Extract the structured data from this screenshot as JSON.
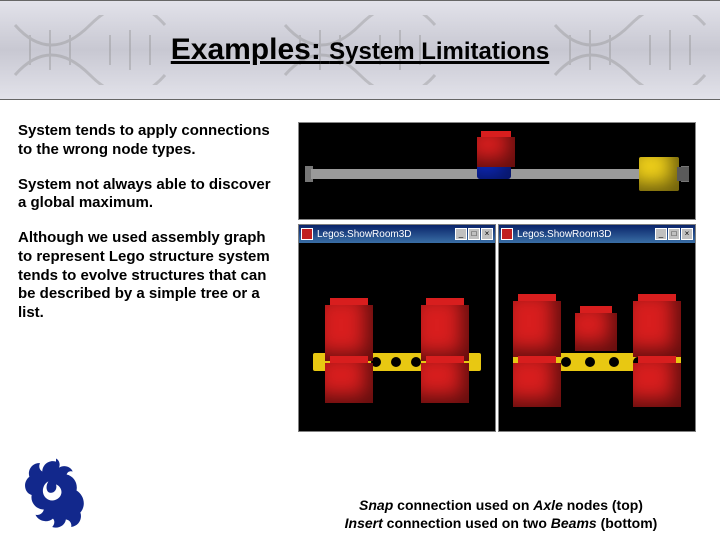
{
  "title": {
    "main": "Examples:",
    "sub": "System Limitations"
  },
  "paragraphs": {
    "p1": "System tends to apply connections to the wrong node types.",
    "p2": "System not always able to discover a global maximum.",
    "p3": "Although we used assembly graph to represent Lego structure system tends to evolve structures that can be described by a simple tree or a list."
  },
  "windows": {
    "win1_title": "Legos.ShowRoom3D",
    "win2_title": "Legos.ShowRoom3D",
    "btn_min": "_",
    "btn_max": "□",
    "btn_close": "×"
  },
  "caption": {
    "line1_a": "Snap",
    "line1_b": " connection used on ",
    "line1_c": "Axle",
    "line1_d": " nodes (top)",
    "line2_a": "Insert",
    "line2_b": " connection used on two ",
    "line2_c": "Beams",
    "line2_d": " (bottom)"
  }
}
